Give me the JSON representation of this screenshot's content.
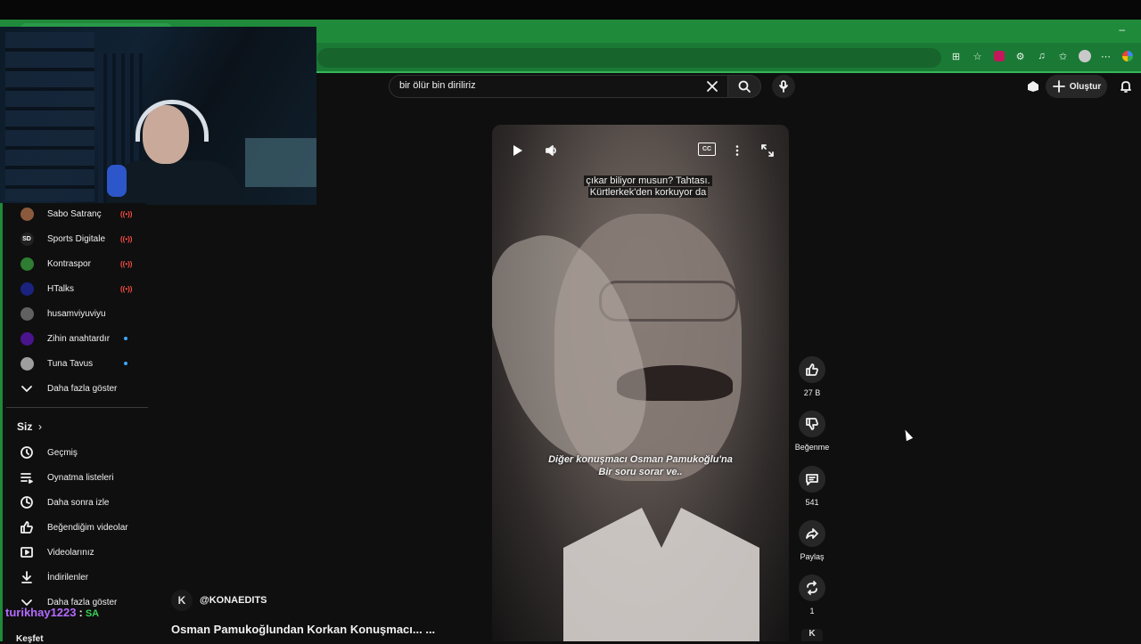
{
  "browser": {
    "window_controls": {
      "minimize": "–"
    },
    "extension_icons": [
      "tab-search-icon",
      "star-icon",
      "extension-pink-icon",
      "extensions-icon",
      "media-icon",
      "bookmarks-icon",
      "profile-icon",
      "menu-icon",
      "google-icon"
    ]
  },
  "header": {
    "search": {
      "value": "bir ölür bin diriliriz"
    },
    "create_label": "Oluştur"
  },
  "sidebar": {
    "subscriptions": [
      {
        "label": "Sabo Satranç",
        "status": "live",
        "avatar_color": "#8b5a3c"
      },
      {
        "label": "Sports Digitale",
        "status": "live",
        "avatar_color": "#222222",
        "avatar_text": "SD"
      },
      {
        "label": "Kontraspor",
        "status": "live",
        "avatar_color": "#2e7d32"
      },
      {
        "label": "HTalks",
        "status": "live",
        "avatar_color": "#1a237e"
      },
      {
        "label": "husamviyuviyu",
        "status": "none",
        "avatar_color": "#616161"
      },
      {
        "label": "Zihin anahtardır",
        "status": "new",
        "avatar_color": "#4a148c"
      },
      {
        "label": "Tuna Tavus",
        "status": "new",
        "avatar_color": "#9e9e9e"
      }
    ],
    "show_more_label": "Daha fazla göster",
    "you_section": {
      "title": "Siz",
      "items": [
        {
          "label": "Geçmiş",
          "icon": "history-icon"
        },
        {
          "label": "Oynatma listeleri",
          "icon": "playlists-icon"
        },
        {
          "label": "Daha sonra izle",
          "icon": "watch-later-icon"
        },
        {
          "label": "Beğendiğim videolar",
          "icon": "liked-icon"
        },
        {
          "label": "Videolarınız",
          "icon": "your-videos-icon"
        },
        {
          "label": "İndirilenler",
          "icon": "downloads-icon"
        }
      ],
      "show_more_label": "Daha fazla göster"
    },
    "explore_label": "Keşfet"
  },
  "chat_overlay": {
    "username": "turikhay1223",
    "message": "SA"
  },
  "short": {
    "subtitle_line1": "çıkar biliyor musun? Tahtası.",
    "subtitle_line2": "Kürtlerkek'den korkuyor da",
    "caption_line1": "Diğer konuşmacı Osman Pamukoğlu'na",
    "caption_line2": "Bir soru sorar ve..",
    "cc_label": "CC",
    "channel_avatar": "K",
    "channel": "@KONAEDITS",
    "title": "Osman Pamukoğlundan Korkan Konuşmacı... ..."
  },
  "actions": {
    "likes": "27 B",
    "dislike_label": "Beğenme",
    "comments": "541",
    "share_label": "Paylaş",
    "remix": "1"
  },
  "colors": {
    "browser_theme": "#1f8a3a",
    "background": "#0f0f0f",
    "live": "#ff4e45",
    "chat_user": "#b36bff",
    "chat_msg": "#39d353"
  }
}
